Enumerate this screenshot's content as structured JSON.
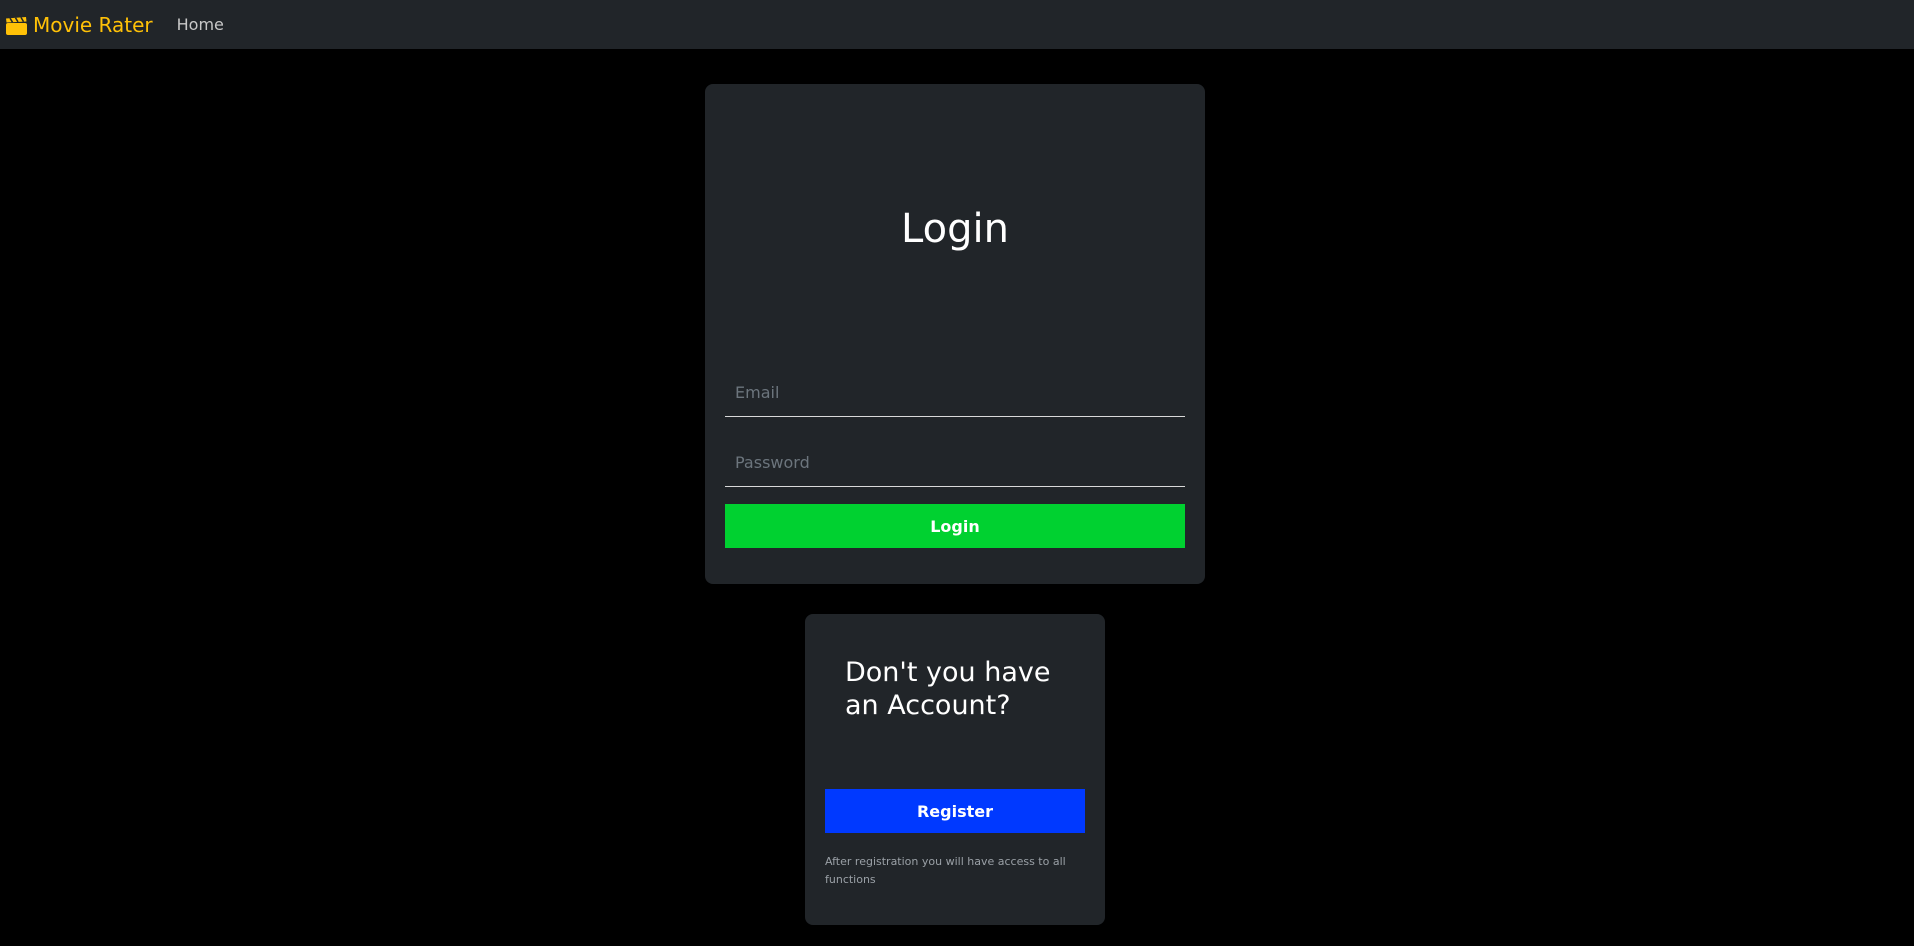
{
  "navbar": {
    "brand_label": "Movie Rater",
    "brand_icon": "clapperboard-icon",
    "links": [
      {
        "label": "Home"
      }
    ]
  },
  "login_card": {
    "title": "Login",
    "email_placeholder": "Email",
    "email_value": "",
    "password_placeholder": "Password",
    "password_value": "",
    "login_button_label": "Login"
  },
  "register_card": {
    "title": "Don't you have an Account?",
    "register_button_label": "Register",
    "note": "After registration you will have access to all functions"
  },
  "colors": {
    "background": "#000000",
    "navbar": "#212529",
    "card": "#212529",
    "brand": "#ffc107",
    "login_button": "#00d130",
    "register_button": "#0039ff"
  }
}
